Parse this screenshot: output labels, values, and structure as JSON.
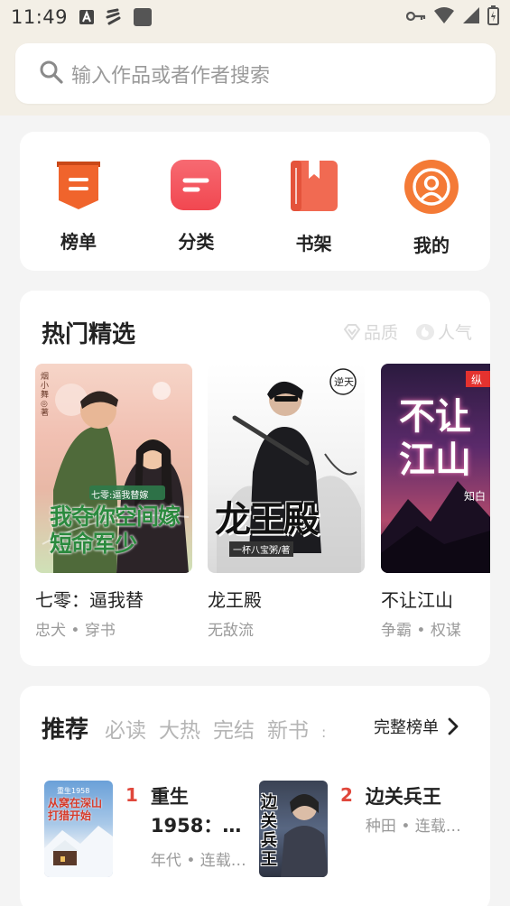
{
  "status_bar": {
    "time": "11:49",
    "left_icons": [
      "a-notification-icon",
      "bolt-notification-icon",
      "square-notification-icon"
    ],
    "right_icons": [
      "key-icon",
      "wifi-icon",
      "signal-icon",
      "battery-charging-icon"
    ]
  },
  "search": {
    "placeholder": "输入作品或者作者搜索"
  },
  "quick_nav": [
    {
      "label": "榜单",
      "icon": "ranking-banner-icon",
      "color": "#f0642c"
    },
    {
      "label": "分类",
      "icon": "category-icon",
      "color": "#f5535b"
    },
    {
      "label": "书架",
      "icon": "bookshelf-icon",
      "color": "#f16a52"
    },
    {
      "label": "我的",
      "icon": "profile-icon",
      "color": "#f47a36"
    }
  ],
  "hot": {
    "title": "热门精选",
    "tags": [
      {
        "label": "品质",
        "icon": "diamond-icon"
      },
      {
        "label": "人气",
        "icon": "hot-badge-icon"
      }
    ],
    "books": [
      {
        "title": "七零：逼我替",
        "meta": "忠犬 • 穿书",
        "cover_text": "我夺你空间嫁短命军少",
        "cover_subtext": "七零:逼我替嫁",
        "cover_author": "烟小舞◎著"
      },
      {
        "title": "龙王殿",
        "meta": "无敌流",
        "cover_text": "龙王殿",
        "cover_subtext": "一杯八宝粥/著",
        "cover_seal": "逆天"
      },
      {
        "title": "不让江山",
        "meta": "争霸 • 权谋",
        "cover_text": "不让江山",
        "cover_author": "知白",
        "cover_publisher": "纵"
      }
    ]
  },
  "recommend": {
    "tabs": [
      "推荐",
      "必读",
      "大热",
      "完结",
      "新书"
    ],
    "more_label": "完整榜单",
    "items": [
      {
        "rank": "1",
        "title_line1": "重生",
        "title_line2": "1958：…",
        "meta": "年代 • 连载…",
        "cover_text": "从窝在深山打猎开始",
        "cover_subtext": "重生1958"
      },
      {
        "rank": "2",
        "title_line1": "边关兵王",
        "title_line2": "",
        "meta": "种田 • 连载…",
        "cover_text": "边关兵王"
      }
    ]
  },
  "colors": {
    "accent": "#e0473b",
    "muted_text": "#9a9a9a",
    "top_bg": "#f3efe6"
  }
}
